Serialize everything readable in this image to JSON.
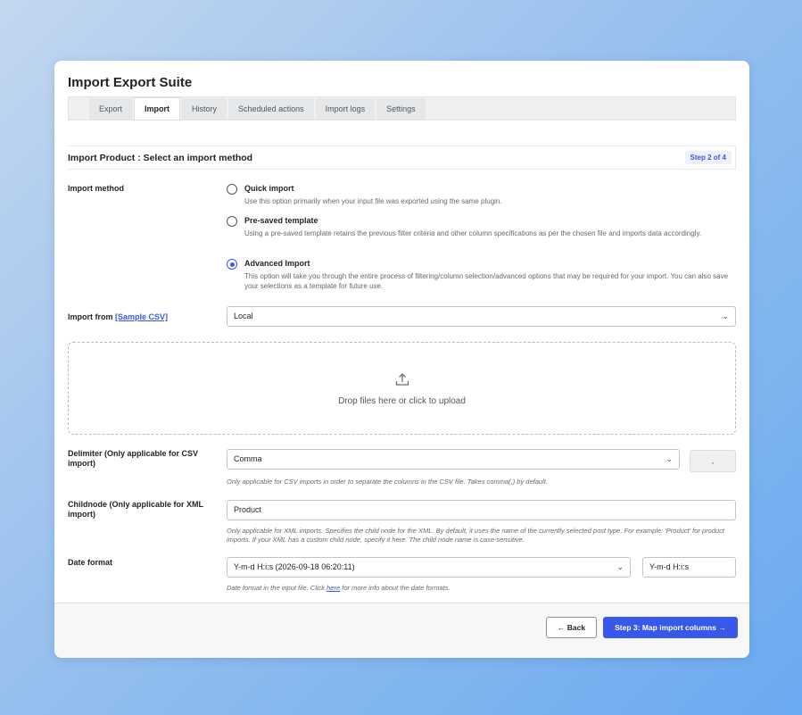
{
  "app": {
    "title": "Import Export Suite"
  },
  "tabs": [
    {
      "label": "Export"
    },
    {
      "label": "Import"
    },
    {
      "label": "History"
    },
    {
      "label": "Scheduled actions"
    },
    {
      "label": "Import logs"
    },
    {
      "label": "Settings"
    }
  ],
  "active_tab": "Import",
  "step": {
    "title": "Import Product : Select an import method",
    "badge": "Step 2 of 4"
  },
  "import_method": {
    "label": "Import method",
    "options": [
      {
        "title": "Quick import",
        "desc": "Use this option primarily when your input file was exported using the same plugin.",
        "checked": false
      },
      {
        "title": "Pre-saved template",
        "desc": "Using a pre-saved template retains the previous filter criteria and other column specifications as per the chosen file and imports data accordingly.",
        "checked": false
      },
      {
        "title": "Advanced Import",
        "desc": "This option will take you through the entire process of filtering/column selection/advanced options that may be required for your import. You can also save your selections as a template for future use.",
        "checked": true
      }
    ]
  },
  "import_from": {
    "label": "Import from",
    "link": "[Sample CSV]",
    "value": "Local"
  },
  "dropzone": {
    "text": "Drop files here or click to upload"
  },
  "delimiter": {
    "label": "Delimiter (Only applicable for CSV import)",
    "value": "Comma",
    "char": ",",
    "help": "Only applicable for CSV imports in order to separate the columns in the CSV file. Takes comma(,) by default."
  },
  "childnode": {
    "label": "Childnode (Only applicable for XML import)",
    "value": "Product",
    "help": "Only applicable for XML imports. Specifies the child node for the XML. By default, it uses the name of the currently selected post type. For example: 'Product' for product imports. If your XML has a custom child node, specify it here. The child node name is case-sensitive."
  },
  "date_format": {
    "label": "Date format",
    "value": "Y-m-d H:i:s (2026-09-18 06:20:11)",
    "custom": "Y-m-d H:i:s",
    "help_before": "Date format in the input file. Click ",
    "help_link": "here",
    "help_after": " for more info about the date formats."
  },
  "footer": {
    "back": "Back",
    "next": "Step 3: Map import columns"
  },
  "colors": {
    "accent": "#3858e9",
    "text": "#1d2327",
    "muted": "#646970"
  }
}
